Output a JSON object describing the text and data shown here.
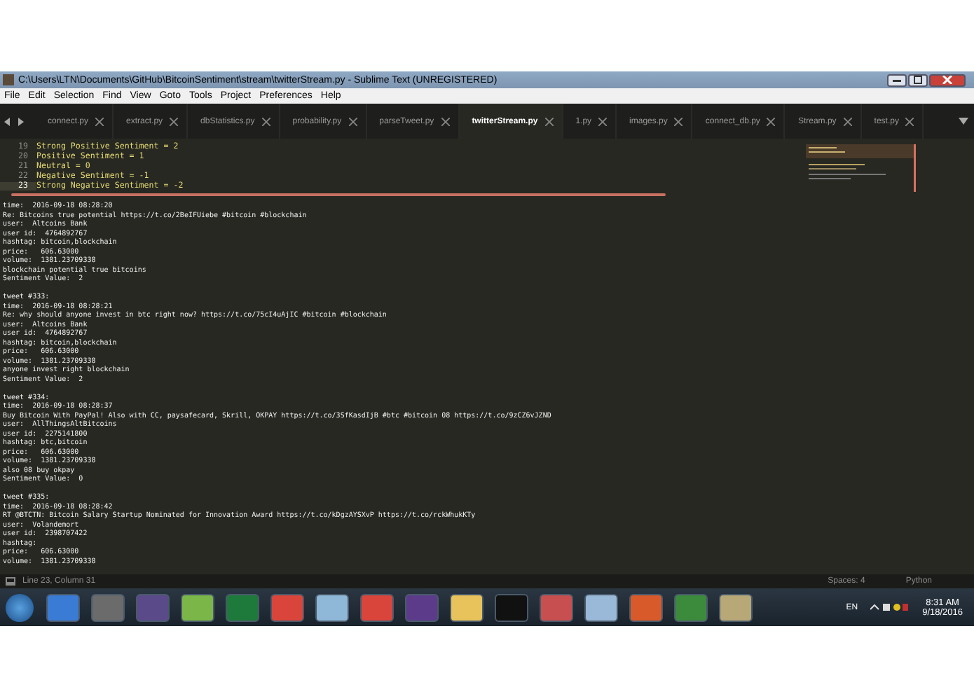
{
  "window": {
    "title": "C:\\Users\\LTN\\Documents\\GitHub\\BitcoinSentiment\\stream\\twitterStream.py - Sublime Text (UNREGISTERED)"
  },
  "menu": [
    "File",
    "Edit",
    "Selection",
    "Find",
    "View",
    "Goto",
    "Tools",
    "Project",
    "Preferences",
    "Help"
  ],
  "tabs": [
    {
      "label": "connect.py",
      "selected": false
    },
    {
      "label": "extract.py",
      "selected": false
    },
    {
      "label": "dbStatistics.py",
      "selected": false
    },
    {
      "label": "probability.py",
      "selected": false
    },
    {
      "label": "parseTweet.py",
      "selected": false
    },
    {
      "label": "twitterStream.py",
      "selected": true
    },
    {
      "label": "1.py",
      "selected": false
    },
    {
      "label": "images.py",
      "selected": false
    },
    {
      "label": "connect_db.py",
      "selected": false
    },
    {
      "label": "Stream.py",
      "selected": false
    },
    {
      "label": "test.py",
      "selected": false
    }
  ],
  "editor": {
    "lines": [
      {
        "number": "19",
        "code": "Strong Positive Sentiment = 2",
        "current": false
      },
      {
        "number": "20",
        "code": "Positive Sentiment = 1",
        "current": false
      },
      {
        "number": "21",
        "code": "Neutral = 0",
        "current": false
      },
      {
        "number": "22",
        "code": "Negative Sentiment = -1",
        "current": false
      },
      {
        "number": "23",
        "code": "Strong Negative Sentiment = -2",
        "current": true
      }
    ]
  },
  "console": {
    "blocks": [
      {
        "lines": [
          "time:  2016-09-18 08:28:20",
          "Re: Bitcoins true potential https://t.co/2BeIFUiebe #bitcoin #blockchain",
          "user:  Altcoins Bank",
          "user id:  4764892767",
          "hashtag: bitcoin,blockchain",
          "price:   606.63000",
          "volume:  1381.23709338",
          "blockchain potential true bitcoins",
          "Sentiment Value:  2"
        ]
      },
      {
        "lines": [
          "tweet #333:",
          "time:  2016-09-18 08:28:21",
          "Re: why should anyone invest in btc right now? https://t.co/75cI4uAjIC #bitcoin #blockchain",
          "user:  Altcoins Bank",
          "user id:  4764892767",
          "hashtag: bitcoin,blockchain",
          "price:   606.63000",
          "volume:  1381.23709338",
          "anyone invest right blockchain",
          "Sentiment Value:  2"
        ]
      },
      {
        "lines": [
          "tweet #334:",
          "time:  2016-09-18 08:28:37",
          "Buy Bitcoin With PayPal! Also with CC, paysafecard, Skrill, OKPAY https://t.co/3SfKasdIjB #btc #bitcoin 08 https://t.co/9zCZ6vJZND",
          "user:  AllThingsAltBitcoins",
          "user id:  2275141800",
          "hashtag: btc,bitcoin",
          "price:   606.63000",
          "volume:  1381.23709338",
          "also 08 buy okpay",
          "Sentiment Value:  0"
        ]
      },
      {
        "lines": [
          "tweet #335:",
          "time:  2016-09-18 08:28:42",
          "RT @BTCTN: Bitcoin Salary Startup Nominated for Innovation Award https://t.co/kDgzAYSXvP https://t.co/rckWhukKTy",
          "user:  Volandemort",
          "user id:  2398707422",
          "hashtag:",
          "price:   606.63000",
          "volume:  1381.23709338"
        ]
      }
    ]
  },
  "status_bar": {
    "position": "Line 23, Column 31",
    "indent": "Spaces: 4",
    "syntax": "Python"
  },
  "taskbar": {
    "language": "EN",
    "time": "8:31 AM",
    "date": "9/18/2016"
  }
}
